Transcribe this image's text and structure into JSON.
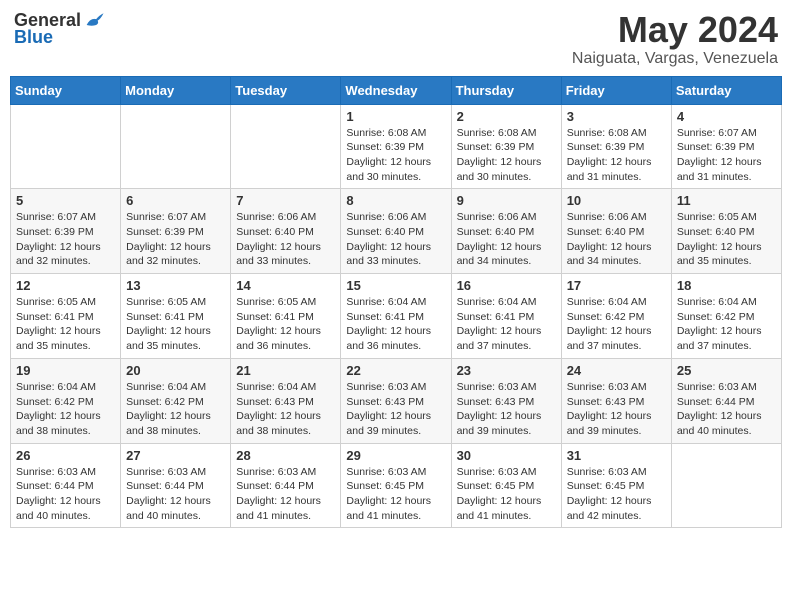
{
  "logo": {
    "text_general": "General",
    "text_blue": "Blue"
  },
  "title": {
    "month_year": "May 2024",
    "location": "Naiguata, Vargas, Venezuela"
  },
  "headers": [
    "Sunday",
    "Monday",
    "Tuesday",
    "Wednesday",
    "Thursday",
    "Friday",
    "Saturday"
  ],
  "weeks": [
    [
      {
        "day": "",
        "content": ""
      },
      {
        "day": "",
        "content": ""
      },
      {
        "day": "",
        "content": ""
      },
      {
        "day": "1",
        "content": "Sunrise: 6:08 AM\nSunset: 6:39 PM\nDaylight: 12 hours\nand 30 minutes."
      },
      {
        "day": "2",
        "content": "Sunrise: 6:08 AM\nSunset: 6:39 PM\nDaylight: 12 hours\nand 30 minutes."
      },
      {
        "day": "3",
        "content": "Sunrise: 6:08 AM\nSunset: 6:39 PM\nDaylight: 12 hours\nand 31 minutes."
      },
      {
        "day": "4",
        "content": "Sunrise: 6:07 AM\nSunset: 6:39 PM\nDaylight: 12 hours\nand 31 minutes."
      }
    ],
    [
      {
        "day": "5",
        "content": "Sunrise: 6:07 AM\nSunset: 6:39 PM\nDaylight: 12 hours\nand 32 minutes."
      },
      {
        "day": "6",
        "content": "Sunrise: 6:07 AM\nSunset: 6:39 PM\nDaylight: 12 hours\nand 32 minutes."
      },
      {
        "day": "7",
        "content": "Sunrise: 6:06 AM\nSunset: 6:40 PM\nDaylight: 12 hours\nand 33 minutes."
      },
      {
        "day": "8",
        "content": "Sunrise: 6:06 AM\nSunset: 6:40 PM\nDaylight: 12 hours\nand 33 minutes."
      },
      {
        "day": "9",
        "content": "Sunrise: 6:06 AM\nSunset: 6:40 PM\nDaylight: 12 hours\nand 34 minutes."
      },
      {
        "day": "10",
        "content": "Sunrise: 6:06 AM\nSunset: 6:40 PM\nDaylight: 12 hours\nand 34 minutes."
      },
      {
        "day": "11",
        "content": "Sunrise: 6:05 AM\nSunset: 6:40 PM\nDaylight: 12 hours\nand 35 minutes."
      }
    ],
    [
      {
        "day": "12",
        "content": "Sunrise: 6:05 AM\nSunset: 6:41 PM\nDaylight: 12 hours\nand 35 minutes."
      },
      {
        "day": "13",
        "content": "Sunrise: 6:05 AM\nSunset: 6:41 PM\nDaylight: 12 hours\nand 35 minutes."
      },
      {
        "day": "14",
        "content": "Sunrise: 6:05 AM\nSunset: 6:41 PM\nDaylight: 12 hours\nand 36 minutes."
      },
      {
        "day": "15",
        "content": "Sunrise: 6:04 AM\nSunset: 6:41 PM\nDaylight: 12 hours\nand 36 minutes."
      },
      {
        "day": "16",
        "content": "Sunrise: 6:04 AM\nSunset: 6:41 PM\nDaylight: 12 hours\nand 37 minutes."
      },
      {
        "day": "17",
        "content": "Sunrise: 6:04 AM\nSunset: 6:42 PM\nDaylight: 12 hours\nand 37 minutes."
      },
      {
        "day": "18",
        "content": "Sunrise: 6:04 AM\nSunset: 6:42 PM\nDaylight: 12 hours\nand 37 minutes."
      }
    ],
    [
      {
        "day": "19",
        "content": "Sunrise: 6:04 AM\nSunset: 6:42 PM\nDaylight: 12 hours\nand 38 minutes."
      },
      {
        "day": "20",
        "content": "Sunrise: 6:04 AM\nSunset: 6:42 PM\nDaylight: 12 hours\nand 38 minutes."
      },
      {
        "day": "21",
        "content": "Sunrise: 6:04 AM\nSunset: 6:43 PM\nDaylight: 12 hours\nand 38 minutes."
      },
      {
        "day": "22",
        "content": "Sunrise: 6:03 AM\nSunset: 6:43 PM\nDaylight: 12 hours\nand 39 minutes."
      },
      {
        "day": "23",
        "content": "Sunrise: 6:03 AM\nSunset: 6:43 PM\nDaylight: 12 hours\nand 39 minutes."
      },
      {
        "day": "24",
        "content": "Sunrise: 6:03 AM\nSunset: 6:43 PM\nDaylight: 12 hours\nand 39 minutes."
      },
      {
        "day": "25",
        "content": "Sunrise: 6:03 AM\nSunset: 6:44 PM\nDaylight: 12 hours\nand 40 minutes."
      }
    ],
    [
      {
        "day": "26",
        "content": "Sunrise: 6:03 AM\nSunset: 6:44 PM\nDaylight: 12 hours\nand 40 minutes."
      },
      {
        "day": "27",
        "content": "Sunrise: 6:03 AM\nSunset: 6:44 PM\nDaylight: 12 hours\nand 40 minutes."
      },
      {
        "day": "28",
        "content": "Sunrise: 6:03 AM\nSunset: 6:44 PM\nDaylight: 12 hours\nand 41 minutes."
      },
      {
        "day": "29",
        "content": "Sunrise: 6:03 AM\nSunset: 6:45 PM\nDaylight: 12 hours\nand 41 minutes."
      },
      {
        "day": "30",
        "content": "Sunrise: 6:03 AM\nSunset: 6:45 PM\nDaylight: 12 hours\nand 41 minutes."
      },
      {
        "day": "31",
        "content": "Sunrise: 6:03 AM\nSunset: 6:45 PM\nDaylight: 12 hours\nand 42 minutes."
      },
      {
        "day": "",
        "content": ""
      }
    ]
  ]
}
